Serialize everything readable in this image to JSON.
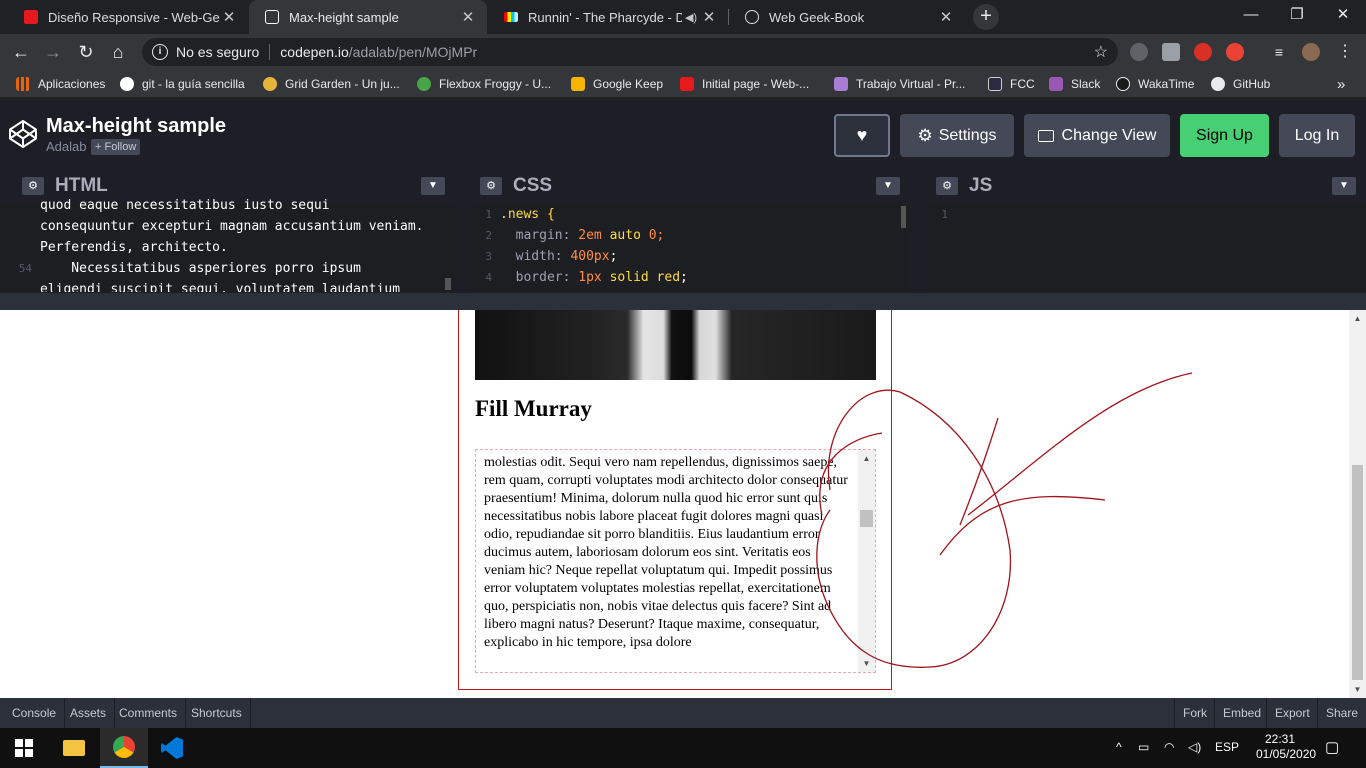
{
  "tabs": [
    {
      "title": "Diseño Responsive - Web-GeekBook",
      "color": "#e8191c"
    },
    {
      "title": "Max-height sample",
      "color": "#ffffff"
    },
    {
      "title": "Runnin' - The Pharcyde - Deezer",
      "color": "#ff9900"
    },
    {
      "title": "Web Geek-Book",
      "color": "#ffffff"
    }
  ],
  "window": {
    "minimize": "—",
    "maximize": "❐",
    "close": "✕",
    "new_tab": "+"
  },
  "omnibox": {
    "security": "No es seguro",
    "url_host": "codepen.io",
    "url_path": "/adalab/pen/MOjMPr"
  },
  "bookmarks": [
    {
      "label": "Aplicaciones",
      "color": "#e8630a"
    },
    {
      "label": "git - la guía sencilla",
      "color": "#ffffff"
    },
    {
      "label": "Grid Garden - Un ju...",
      "color": "#e5b53a"
    },
    {
      "label": "Flexbox Froggy - U...",
      "color": "#47a447"
    },
    {
      "label": "Google Keep",
      "color": "#f7b500"
    },
    {
      "label": "Initial page - Web-...",
      "color": "#e8191c"
    },
    {
      "label": "Trabajo Virtual - Pr...",
      "color": "#a77dd6"
    },
    {
      "label": "FCC",
      "color": "#2a2a40"
    },
    {
      "label": "Slack",
      "color": "#9b59b6"
    },
    {
      "label": "WakaTime",
      "color": "#1a1a1a"
    },
    {
      "label": "GitHub",
      "color": "#1a1a1a"
    }
  ],
  "bookmarks_more": "»",
  "pen": {
    "title": "Max-height sample",
    "author": "Adalab",
    "follow": "+ Follow",
    "buttons": {
      "settings": "Settings",
      "change_view": "Change View",
      "signup": "Sign Up",
      "login": "Log In"
    }
  },
  "editors": {
    "html": {
      "name": "HTML",
      "lines": [
        {
          "n": "",
          "text": "quod eaque necessitatibus iusto sequi"
        },
        {
          "n": "",
          "text": "consequuntur excepturi magnam accusantium veniam."
        },
        {
          "n": "",
          "text": "Perferendis, architecto."
        },
        {
          "n": "54",
          "text": "    Necessitatibus asperiores porro ipsum"
        },
        {
          "n": "",
          "text": "eligendi suscipit sequi, voluptatem laudantium"
        }
      ]
    },
    "css": {
      "name": "CSS",
      "lines": [
        {
          "n": "1",
          "sel": ".news {",
          "prop": "",
          "val": "",
          "kw": "",
          "rest": ""
        },
        {
          "n": "2",
          "sel": "",
          "prop": "  margin: ",
          "val": "2em",
          "kw": " auto ",
          "rest": "0;"
        },
        {
          "n": "3",
          "sel": "",
          "prop": "  width: ",
          "val": "400px",
          "kw": "",
          "rest": ";"
        },
        {
          "n": "4",
          "sel": "",
          "prop": "  border: ",
          "val": "1px",
          "kw": " solid red",
          "rest": ";"
        }
      ]
    },
    "js": {
      "name": "JS",
      "lines": [
        {
          "n": "1",
          "text": ""
        }
      ]
    }
  },
  "preview": {
    "heading": "Fill Murray",
    "text": "molestias odit. Sequi vero nam repellendus, dignissimos saepe, rem quam, corrupti voluptates modi architecto dolor consequatur praesentium! Minima, dolorum nulla quod hic error sunt quis necessitatibus nobis labore placeat fugit dolores magni quasi odio, repudiandae sit porro blanditiis. Eius laudantium error ducimus autem, laboriosam dolorum eos sint. Veritatis eos veniam hic? Neque repellat voluptatum qui. Impedit possimus error voluptatem voluptates molestias repellat, exercitationem quo, perspiciatis non, nobis vitae delectus quis facere? Sint ad libero magni natus? Deserunt? Itaque maxime, consequatur, explicabo in hic tempore, ipsa dolore"
  },
  "footer": {
    "left": [
      "Console",
      "Assets",
      "Comments",
      "Shortcuts"
    ],
    "right": [
      "Fork",
      "Embed",
      "Export",
      "Share"
    ]
  },
  "taskbar": {
    "language": "ESP",
    "time": "22:31",
    "date": "01/05/2020"
  },
  "colors": {
    "accent_green": "#47cf73",
    "border_red": "#c0191c",
    "scribble": "#a0141c"
  }
}
